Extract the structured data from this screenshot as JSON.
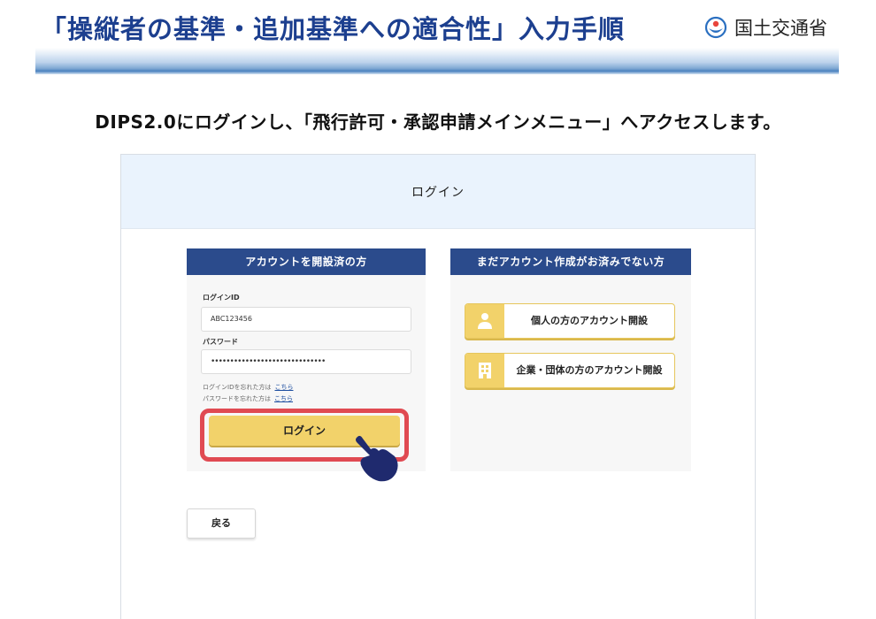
{
  "slide": {
    "title": "「操縦者の基準・追加基準への適合性」入力手順",
    "ministry": "国土交通省",
    "instruction": "DIPS2.0にログインし、「飛行許可・承認申請メインメニュー」へアクセスします。"
  },
  "login_page": {
    "title": "ログイン",
    "existing_account": {
      "heading": "アカウントを開設済の方",
      "login_id_label": "ログインID",
      "login_id_value": "ABC123456",
      "password_label": "パスワード",
      "password_value": "••••••••••••••••••••••••••••••",
      "forgot_id_text": "ログインIDを忘れた方は",
      "forgot_password_text": "パスワードを忘れた方は",
      "here_link": "こちら",
      "login_button": "ログイン"
    },
    "new_account": {
      "heading": "まだアカウント作成がお済みでない方",
      "individual_button": "個人の方のアカウント開設",
      "corporate_button": "企業・団体の方のアカウント開設"
    },
    "back_button": "戻る"
  },
  "colors": {
    "title_blue": "#1c3f8f",
    "card_header_navy": "#2b4b8c",
    "button_yellow": "#f2d26a",
    "highlight_red": "#e04a52",
    "pointer_navy": "#1f2a6e",
    "panel_header_bg": "#eaf3fd"
  },
  "icons": {
    "ministry_logo": "mlit-logo-icon",
    "individual": "person-icon",
    "corporate": "building-icon",
    "pointer": "pointing-hand-icon"
  }
}
